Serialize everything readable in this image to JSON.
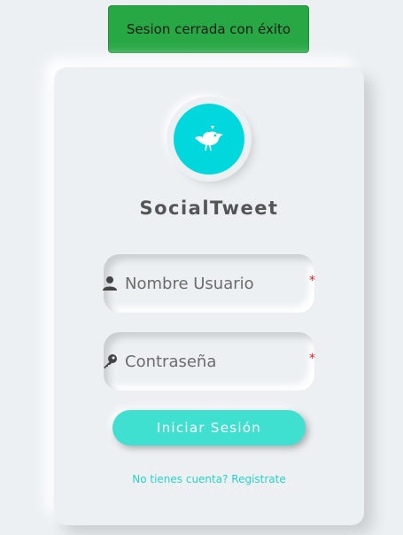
{
  "toast": {
    "message": "Sesion cerrada con éxito",
    "color": "#28a745"
  },
  "brand": {
    "icon": "bird-icon",
    "title": "SocialTweet",
    "accent": "#00d8de"
  },
  "form": {
    "username": {
      "icon": "user-icon",
      "placeholder": "Nombre Usuario",
      "value": "",
      "required_mark": "*"
    },
    "password": {
      "icon": "key-icon",
      "placeholder": "Contraseña",
      "value": "",
      "required_mark": "*"
    },
    "submit_label": "Iniciar Sesión",
    "button_color": "#40e0d0"
  },
  "register_link": "No tienes cuenta? Registrate"
}
